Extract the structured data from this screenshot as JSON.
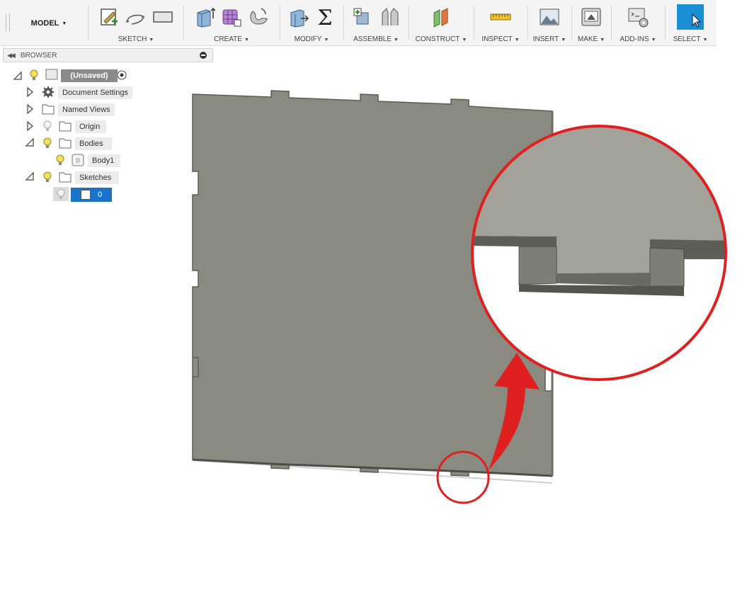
{
  "toolbar": {
    "model_label": "MODEL",
    "groups": [
      {
        "label": "SKETCH",
        "icons": [
          "create-sketch-icon",
          "spline-icon",
          "rectangle-icon"
        ]
      },
      {
        "label": "CREATE",
        "icons": [
          "extrude-icon",
          "form-icon",
          "revolve-icon"
        ]
      },
      {
        "label": "MODIFY",
        "icons": [
          "press-pull-icon",
          "parameters-sigma-icon"
        ]
      },
      {
        "label": "ASSEMBLE",
        "icons": [
          "new-component-icon",
          "joint-icon"
        ]
      },
      {
        "label": "CONSTRUCT",
        "icons": [
          "offset-plane-icon"
        ]
      },
      {
        "label": "INSPECT",
        "icons": [
          "measure-icon"
        ]
      },
      {
        "label": "INSERT",
        "icons": [
          "insert-image-icon"
        ]
      },
      {
        "label": "MAKE",
        "icons": [
          "3d-print-icon"
        ]
      },
      {
        "label": "ADD-INS",
        "icons": [
          "scripts-icon"
        ]
      },
      {
        "label": "SELECT",
        "icons": [
          "select-cursor-icon"
        ]
      }
    ]
  },
  "browser": {
    "title": "BROWSER",
    "root_label": "(Unsaved)",
    "items": [
      {
        "label": "Document Settings",
        "icon": "gear-icon",
        "expanded": false
      },
      {
        "label": "Named Views",
        "icon": "folder-icon",
        "expanded": false
      },
      {
        "label": "Origin",
        "icon": "folder-icon",
        "expanded": false
      },
      {
        "label": "Bodies",
        "icon": "folder-icon",
        "expanded": true
      },
      {
        "label": "Body1",
        "icon": "body-icon",
        "expanded": null
      },
      {
        "label": "Sketches",
        "icon": "folder-icon",
        "expanded": true
      },
      {
        "label": "0",
        "icon": "sketch-icon",
        "expanded": null
      }
    ]
  },
  "colors": {
    "panel_face": "#8a8a80",
    "panel_edge": "#5c5c55",
    "annotation_red": "#e02020",
    "selection_blue": "#1a73c8",
    "select_tool_bg": "#1a8fd6"
  }
}
